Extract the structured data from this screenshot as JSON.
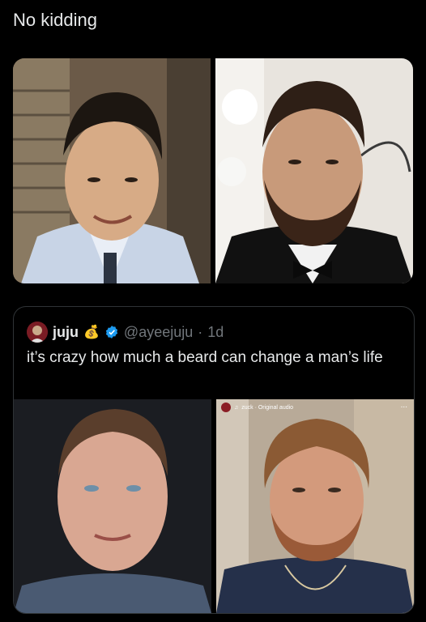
{
  "post": {
    "text": "No kidding"
  },
  "quote": {
    "display_name": "juju",
    "emoji": "💰",
    "handle": "@ayeejuju",
    "separator": "·",
    "age": "1d",
    "text": "it’s crazy how much a beard can change a man’s life"
  },
  "reel": {
    "label": "zuck · Original audio",
    "menu": "..."
  },
  "colors": {
    "background": "#000000",
    "verified": "#1d9bf0",
    "secondary_text": "#71767b"
  }
}
